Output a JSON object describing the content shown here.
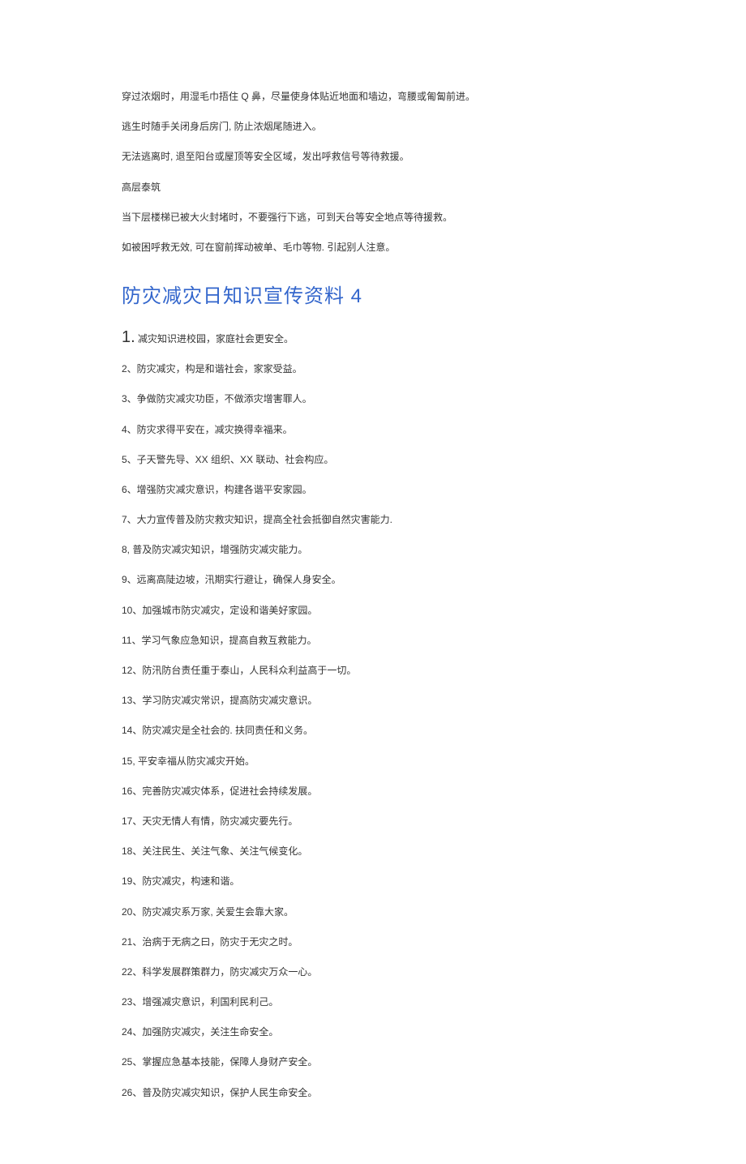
{
  "paras": [
    "穿过浓烟时，用湿毛巾捂住 Q 鼻，尽量使身体贴近地面和墙边，弯腰或匍匐前进。",
    "逃生时随手关闭身后房门, 防止浓烟尾随进入。",
    "无法逃离时, 退至阳台或屋顶等安全区域，发出呼救信号等待救援。",
    "高层泰筑",
    "当下层楼梯已被大火封堵时，不要强行下逃，可到天台等安全地点等待援救。",
    "如被困呼救无效, 可在窗前挥动被单、毛巾等物. 引起别人注意。"
  ],
  "heading": "防灾减灾日知识宣传资料 4",
  "items": [
    {
      "num_big": "1.",
      "text": " 减灾知识进校园，家庭社会更安全。"
    },
    {
      "text": "2、防灾减灾，构是和谐社会，家家受益。"
    },
    {
      "text": "3、争做防灾减灾功臣，不做添灾增害罪人。"
    },
    {
      "text": "4、防灾求得平安在，减灾换得幸福来。"
    },
    {
      "text": "5、子天警先导、XX 组织、XX 联动、社会构应。"
    },
    {
      "text": "6、增强防灾减灾意识，构建各谐平安家园。"
    },
    {
      "text": "7、大力宣传普及防灾救灾知识，提高全社会抵御自然灾害能力."
    },
    {
      "text": "8, 普及防灾减灾知识，增强防灾减灾能力。"
    },
    {
      "text": "9、远离高陡边坡，汛期实行避让，确保人身安全。"
    },
    {
      "text": "10、加强城市防灾减灾，定设和谐美好家园。"
    },
    {
      "text": "11、学习气象应急知识，提高自救互救能力。"
    },
    {
      "text": "12、防汛防台责任重于泰山，人民科众利益高于一切。"
    },
    {
      "text": "13、学习防灾减灾常识，提高防灾减灾意识。"
    },
    {
      "text": "14、防灾减灾是全社会的. 扶同责任和义务。"
    },
    {
      "text": "15, 平安幸福从防灾减灾开始。"
    },
    {
      "text": "16、完善防灾减灾体系，促进社会持续发展。"
    },
    {
      "text": "17、天灾无情人有情，防灾减灾要先行。"
    },
    {
      "text": "18、关注民生、关注气象、关注气候变化。"
    },
    {
      "text": "19、防灾减灾，构速和谐。"
    },
    {
      "text": "20、防灾减灾系万家, 关爱生会靠大家。"
    },
    {
      "text": "21、治病于无病之曰，防灾于无灾之时。"
    },
    {
      "text": "22、科学发展群策群力，防灾减灾万众一心。"
    },
    {
      "text": "23、增强减灾意识，利国利民利己。"
    },
    {
      "text": "24、加强防灾减灾，关注生命安全。"
    },
    {
      "text": "25、掌握应急基本技能，保障人身财产安全。"
    },
    {
      "text": "26、普及防灾减灾知识，保护人民生命安全。"
    }
  ]
}
